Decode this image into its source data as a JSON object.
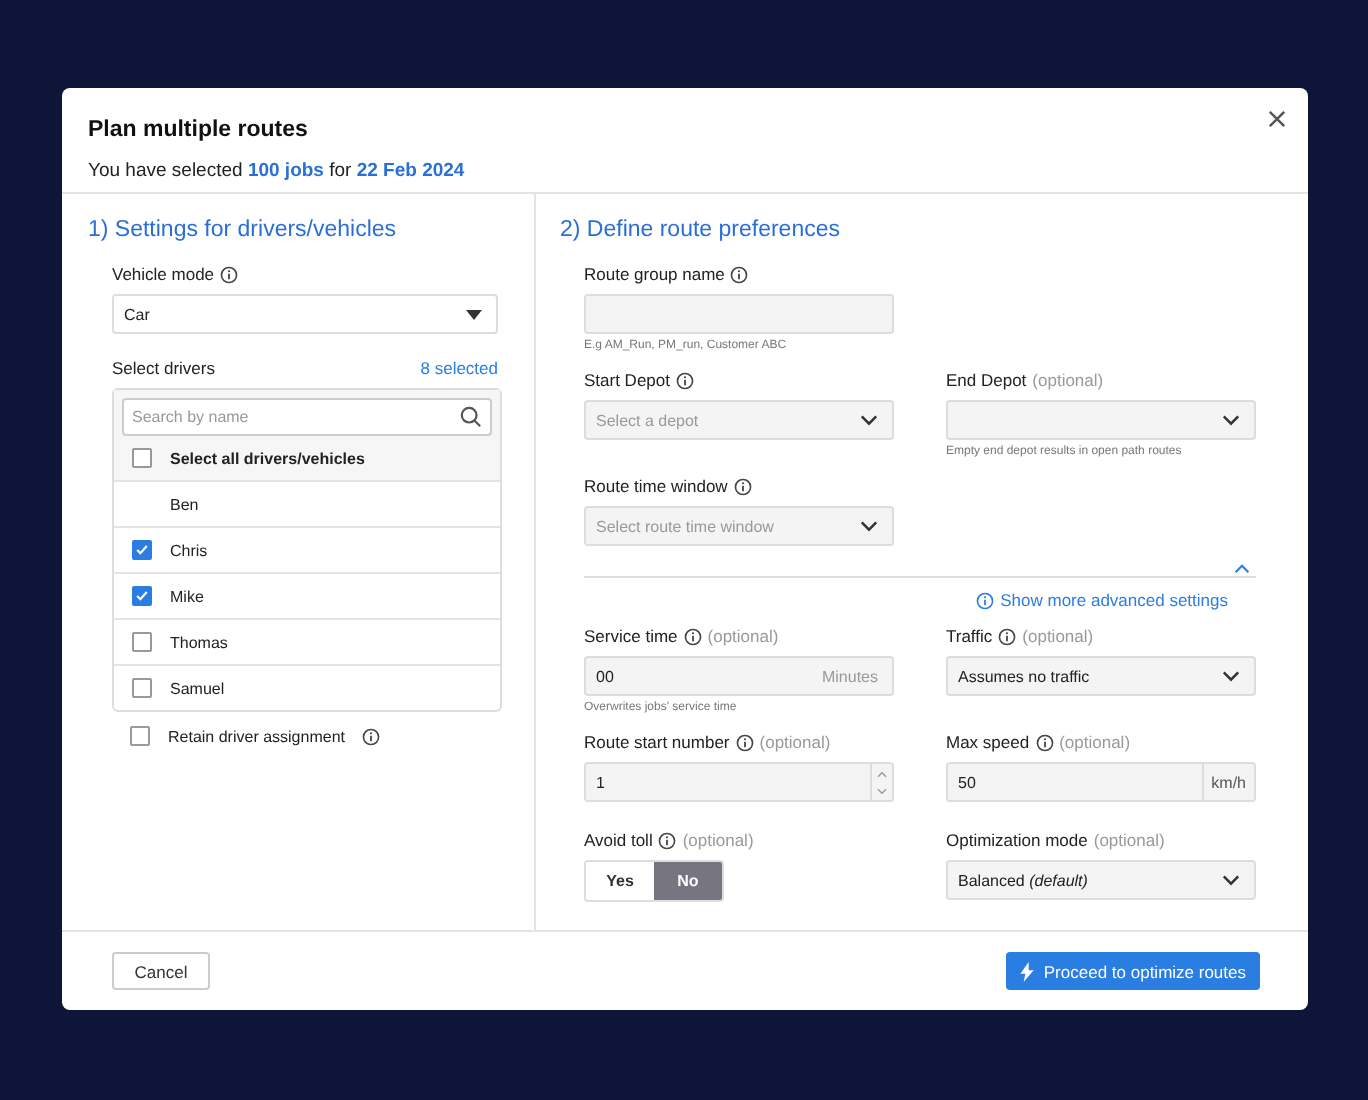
{
  "dialog": {
    "title": "Plan multiple routes",
    "subtitle": "You have selected **100 jobs** for **22 Feb 2024**"
  },
  "left": {
    "heading": "1) Settings for drivers/vehicles",
    "vehicle_mode": {
      "label": "Vehicle mode",
      "value": "Car"
    },
    "drivers": {
      "label": "Select drivers",
      "count": "8 selected",
      "search_placeholder": "Search by name",
      "select_all": {
        "label": "Select all drivers/vehicles",
        "checked": false
      },
      "items": [
        {
          "name": "Ben",
          "kind": "plain"
        },
        {
          "name": "Chris",
          "kind": "checkbox",
          "checked": true
        },
        {
          "name": "Mike",
          "kind": "checkbox",
          "checked": true
        },
        {
          "name": "Thomas",
          "kind": "checkbox",
          "checked": false
        },
        {
          "name": "Samuel",
          "kind": "checkbox",
          "checked": false
        }
      ]
    },
    "retain": {
      "label": "Retain driver assignment",
      "checked": false
    }
  },
  "right": {
    "heading": "2) Define route preferences",
    "basic_rows": [
      [
        {
          "kind": "text",
          "label": "Route group name",
          "info": true,
          "hint": "E.g AM_Run, PM_run, Customer ABC"
        }
      ],
      [
        {
          "kind": "select",
          "label": "Start Depot",
          "info": true,
          "placeholder": "Select a depot"
        },
        {
          "kind": "select",
          "label": "End Depot",
          "optional": "(optional)",
          "hint": "Empty end depot results in open path routes"
        }
      ],
      [
        {
          "kind": "select",
          "label": "Route time window",
          "info": true,
          "placeholder": "Select route time window"
        }
      ]
    ],
    "advanced_toggle": {
      "label": "Show more advanced settings",
      "expanded": true
    },
    "advanced_rows": [
      [
        {
          "kind": "unit",
          "label": "Service time",
          "info": true,
          "optional": "(optional)",
          "value": "00",
          "unit": "Minutes",
          "hint": "Overwrites jobs' service time"
        },
        {
          "kind": "select",
          "label": "Traffic",
          "info": true,
          "optional": "(optional)",
          "value": "Assumes no traffic"
        }
      ],
      [
        {
          "kind": "stepper",
          "label": "Route start number",
          "info": true,
          "optional": "(optional)",
          "value": "1"
        },
        {
          "kind": "addon",
          "label": "Max speed",
          "info": true,
          "optional": "(optional)",
          "value": "50",
          "unit": "km/h"
        }
      ],
      [
        {
          "kind": "toggle",
          "label": "Avoid toll",
          "info": true,
          "optional": "(optional)",
          "options": [
            {
              "label": "Yes",
              "selected": false
            },
            {
              "label": "No",
              "selected": true
            }
          ]
        },
        {
          "kind": "select",
          "label": "Optimization mode",
          "optional": "(optional)",
          "value": "Balanced *(default)*"
        }
      ]
    ]
  },
  "footer": {
    "cancel": "Cancel",
    "proceed": "Proceed to optimize routes"
  }
}
